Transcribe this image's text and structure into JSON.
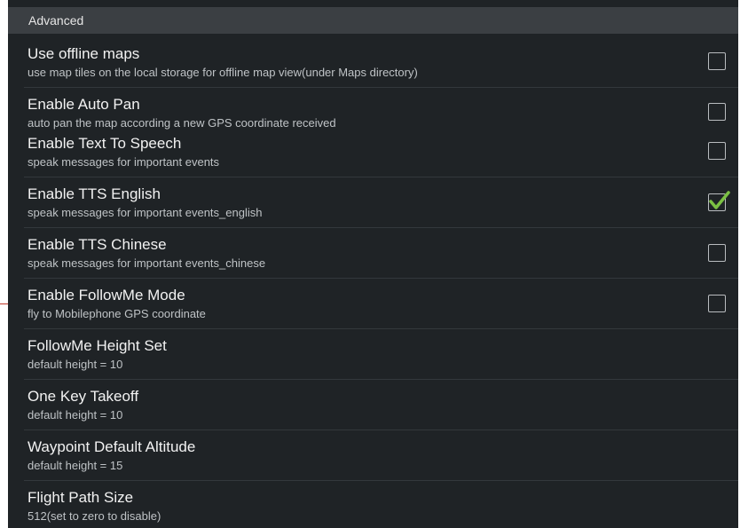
{
  "section": {
    "header": "Advanced"
  },
  "settings": [
    {
      "title": "Use offline maps",
      "summary": "use map tiles on the local storage for offline map view(under Maps directory)",
      "checked": false
    },
    {
      "title": "Enable Auto Pan",
      "summary": "auto pan the map according a new GPS coordinate received",
      "checked": false
    },
    {
      "title": "Enable Text To Speech",
      "summary": "speak messages for important events",
      "checked": false
    },
    {
      "title": "Enable TTS English",
      "summary": "speak messages for important events_english",
      "checked": true
    },
    {
      "title": "Enable TTS Chinese",
      "summary": "speak messages for important events_chinese",
      "checked": false
    },
    {
      "title": "Enable FollowMe Mode",
      "summary": "fly to Mobilephone GPS coordinate",
      "checked": false
    },
    {
      "title": "FollowMe Height Set",
      "summary": "default height = 10"
    },
    {
      "title": "One Key Takeoff",
      "summary": "default height = 10"
    },
    {
      "title": "Waypoint Default Altitude",
      "summary": "default height = 15"
    },
    {
      "title": "Flight Path Size",
      "summary": "512(set to zero to disable)"
    }
  ],
  "colors": {
    "background": "#1f2326",
    "header": "#3b3f43",
    "check_accent": "#7bc043"
  }
}
